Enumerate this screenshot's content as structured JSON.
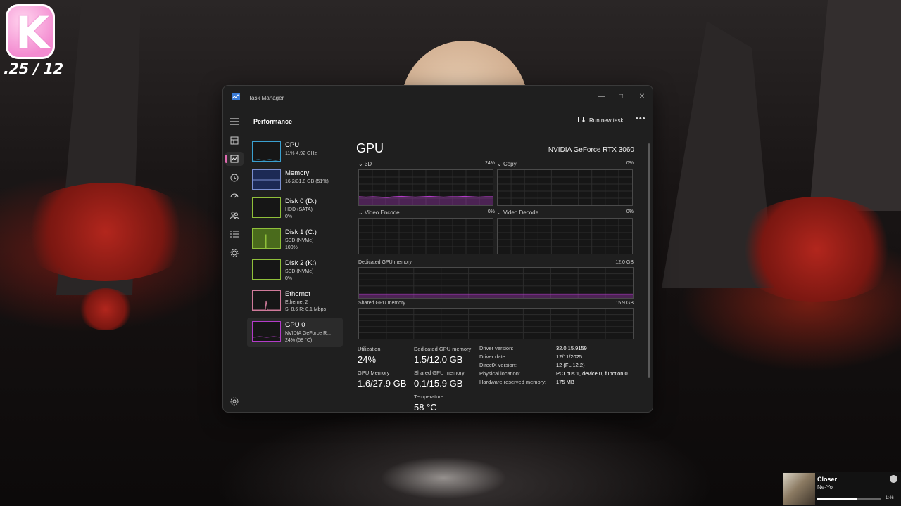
{
  "overlay": {
    "logo_letter": "K",
    "date_text": ".25 / 12"
  },
  "window": {
    "title": "Task Manager",
    "section_title": "Performance",
    "run_new_task": "Run new task",
    "more_label": "•••",
    "nav_icons": [
      "hamburger-menu-icon",
      "processes-icon",
      "performance-icon",
      "app-history-icon",
      "startup-apps-icon",
      "users-icon",
      "details-icon",
      "services-icon"
    ],
    "accent_color": "#e06ab0"
  },
  "devices": [
    {
      "name": "CPU",
      "sub1": "11% 4.92 GHz",
      "sub2": "",
      "color": "#3aa0d0",
      "thumb_fill": "#161616"
    },
    {
      "name": "Memory",
      "sub1": "16.2/31.8 GB (51%)",
      "sub2": "",
      "color": "#7a8fd0",
      "thumb_fill": "#1c2a55"
    },
    {
      "name": "Disk 0 (D:)",
      "sub1": "HDD (SATA)",
      "sub2": "0%",
      "color": "#8fbf3a",
      "thumb_fill": "#161616"
    },
    {
      "name": "Disk 1 (C:)",
      "sub1": "SSD (NVMe)",
      "sub2": "100%",
      "color": "#8fbf3a",
      "thumb_fill": "#4a6b1c"
    },
    {
      "name": "Disk 2 (K:)",
      "sub1": "SSD (NVMe)",
      "sub2": "0%",
      "color": "#8fbf3a",
      "thumb_fill": "#161616"
    },
    {
      "name": "Ethernet",
      "sub1": "Ethernet 2",
      "sub2": "S: 8.6  R: 0.1 Mbps",
      "color": "#d07a9a",
      "thumb_fill": "#161616"
    },
    {
      "name": "GPU 0",
      "sub1": "NVIDIA GeForce R...",
      "sub2": "24% (58 °C)",
      "color": "#b23cc8",
      "thumb_fill": "#161616"
    }
  ],
  "gpu": {
    "title": "GPU",
    "model": "NVIDIA GeForce RTX 3060",
    "engines": [
      {
        "label": "3D",
        "percent": "24%"
      },
      {
        "label": "Copy",
        "percent": "0%"
      },
      {
        "label": "Video Encode",
        "percent": "0%"
      },
      {
        "label": "Video Decode",
        "percent": "0%"
      }
    ],
    "dedicated_label": "Dedicated GPU memory",
    "dedicated_max": "12.0 GB",
    "shared_label": "Shared GPU memory",
    "shared_max": "15.9 GB",
    "stats": {
      "utilization_label": "Utilization",
      "utilization_value": "24%",
      "dedicated_label": "Dedicated GPU memory",
      "dedicated_value": "1.5/12.0 GB",
      "gpu_memory_label": "GPU Memory",
      "gpu_memory_value": "1.6/27.9 GB",
      "shared_label": "Shared GPU memory",
      "shared_value": "0.1/15.9 GB",
      "temperature_label": "Temperature",
      "temperature_value": "58 °C"
    },
    "info": [
      {
        "key": "Driver version:",
        "value": "32.0.15.9159"
      },
      {
        "key": "Driver date:",
        "value": "12/11/2025"
      },
      {
        "key": "DirectX version:",
        "value": "12 (FL 12.2)"
      },
      {
        "key": "Physical location:",
        "value": "PCI bus 1, device 0, function 0"
      },
      {
        "key": "Hardware reserved memory:",
        "value": "175 MB"
      }
    ],
    "graph_color": "#b23cc8",
    "three_d_series": [
      0.24,
      0.23,
      0.24,
      0.23,
      0.22,
      0.24,
      0.25,
      0.24,
      0.23,
      0.24,
      0.25,
      0.24,
      0.23,
      0.24,
      0.24,
      0.25,
      0.24,
      0.23,
      0.24,
      0.24
    ],
    "dedicated_fraction": 0.125
  },
  "media": {
    "song": "Closer",
    "artist": "Ne-Yo",
    "remaining": "-1:46",
    "progress": 0.62
  }
}
